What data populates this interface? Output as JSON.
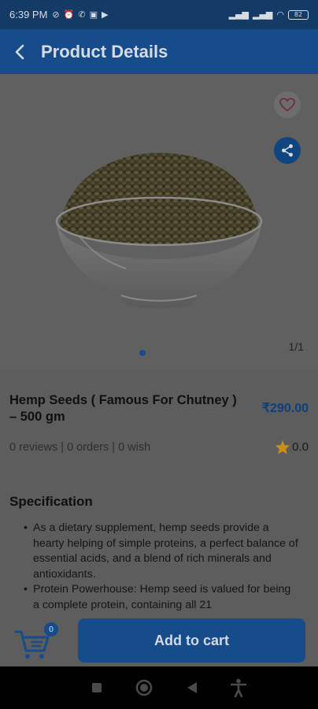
{
  "status_bar": {
    "time": "6:39 PM",
    "battery": "82",
    "icons": [
      "do-not-disturb-icon",
      "alarm-icon",
      "call-icon",
      "notification-icon",
      "play-icon",
      "signal-icon",
      "signal-icon",
      "wifi-icon",
      "battery-icon"
    ]
  },
  "app_bar": {
    "title": "Product Details",
    "back_icon": "chevron-left-icon"
  },
  "gallery": {
    "counter": "1/1",
    "favorite_icon": "heart-icon",
    "share_icon": "share-icon"
  },
  "product": {
    "name": "Hemp Seeds ( Famous For Chutney ) – 500 gm",
    "price": "₹290.00",
    "stats": "0 reviews | 0 orders | 0 wish",
    "rating": "0.0"
  },
  "specification": {
    "title": "Specification",
    "items": [
      "As a dietary supplement, hemp seeds provide a hearty helping of simple proteins, a perfect balance of essential acids, and a blend of rich minerals and antioxidants.",
      "Protein Powerhouse: Hemp seed is valued for being a complete protein, containing all 21"
    ]
  },
  "cart": {
    "count": "0",
    "add_label": "Add to cart"
  },
  "colors": {
    "accent": "#164c8c",
    "star": "#c8901a"
  }
}
